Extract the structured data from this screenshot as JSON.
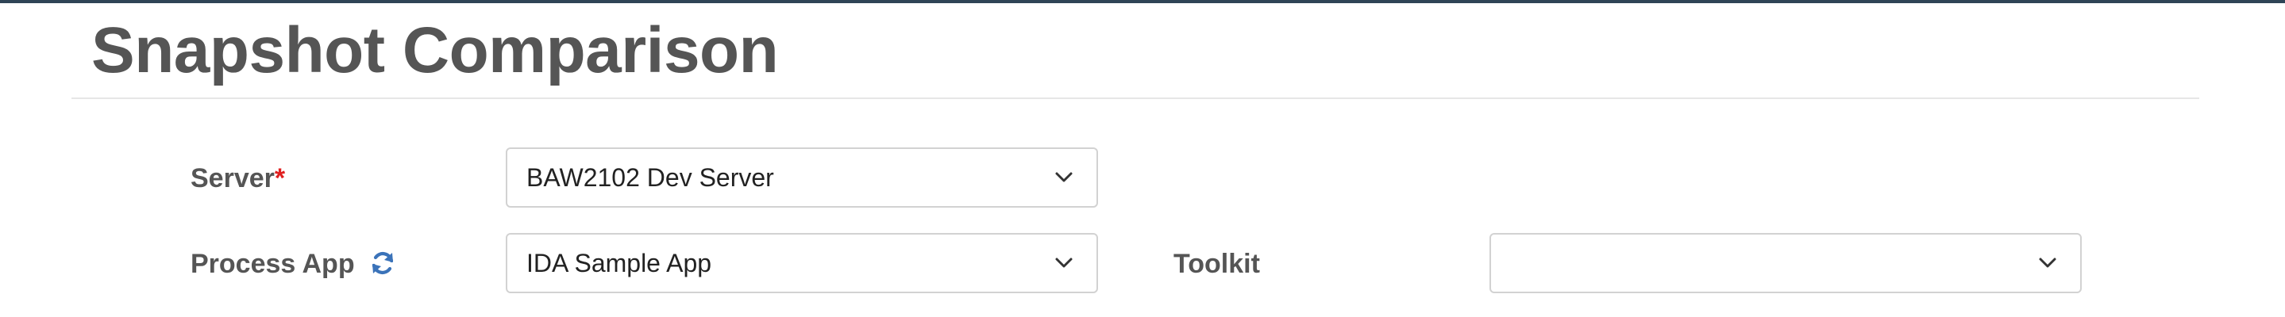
{
  "page": {
    "title": "Snapshot Comparison"
  },
  "form": {
    "server": {
      "label": "Server",
      "required_mark": "*",
      "selected": "BAW2102 Dev Server"
    },
    "process_app": {
      "label": "Process App",
      "refresh_icon": "refresh-icon",
      "selected": "IDA Sample App"
    },
    "toolkit": {
      "label": "Toolkit",
      "selected": ""
    }
  },
  "colors": {
    "top_bar": "#2f4456",
    "required": "#e02020",
    "refresh_icon": "#3b73b9",
    "label_text": "#555555",
    "border": "#d2d2d2"
  }
}
